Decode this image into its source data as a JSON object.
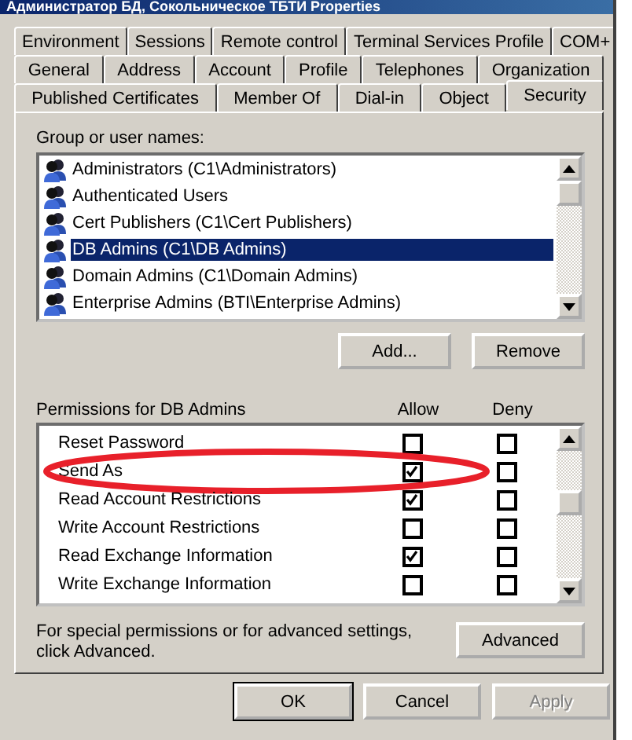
{
  "window": {
    "title": "Администратор БД, Сокольническое ТБТИ Properties"
  },
  "tab_rows": [
    [
      {
        "label": "Environment",
        "selected": false
      },
      {
        "label": "Sessions",
        "selected": false
      },
      {
        "label": "Remote control",
        "selected": false
      },
      {
        "label": "Terminal Services Profile",
        "selected": false
      },
      {
        "label": "COM+",
        "selected": false
      }
    ],
    [
      {
        "label": "General",
        "selected": false
      },
      {
        "label": "Address",
        "selected": false
      },
      {
        "label": "Account",
        "selected": false
      },
      {
        "label": "Profile",
        "selected": false
      },
      {
        "label": "Telephones",
        "selected": false
      },
      {
        "label": "Organization",
        "selected": false
      }
    ],
    [
      {
        "label": "Published Certificates",
        "selected": false
      },
      {
        "label": "Member Of",
        "selected": false
      },
      {
        "label": "Dial-in",
        "selected": false
      },
      {
        "label": "Object",
        "selected": false
      },
      {
        "label": "Security",
        "selected": true
      }
    ]
  ],
  "groups": {
    "label": "Group or user names:",
    "items": [
      {
        "name": "Administrators (C1\\Administrators)",
        "selected": false
      },
      {
        "name": "Authenticated Users",
        "selected": false
      },
      {
        "name": "Cert Publishers (C1\\Cert Publishers)",
        "selected": false
      },
      {
        "name": "DB Admins (C1\\DB Admins)",
        "selected": true
      },
      {
        "name": "Domain Admins (C1\\Domain Admins)",
        "selected": false
      },
      {
        "name": "Enterprise Admins (BTI\\Enterprise Admins)",
        "selected": false
      }
    ],
    "buttons": [
      "Add...",
      "Remove"
    ]
  },
  "permissions": {
    "label": "Permissions for DB Admins",
    "allow_header": "Allow",
    "deny_header": "Deny",
    "rows": [
      {
        "name": "Reset Password",
        "allow": false,
        "deny": false,
        "highlighted": false
      },
      {
        "name": "Send As",
        "allow": true,
        "deny": false,
        "highlighted": true
      },
      {
        "name": "Read Account Restrictions",
        "allow": true,
        "deny": false,
        "highlighted": false
      },
      {
        "name": "Write Account Restrictions",
        "allow": false,
        "deny": false,
        "highlighted": false
      },
      {
        "name": "Read Exchange Information",
        "allow": true,
        "deny": false,
        "highlighted": false
      },
      {
        "name": "Write Exchange Information",
        "allow": false,
        "deny": false,
        "highlighted": false
      }
    ]
  },
  "advanced": {
    "note": "For special permissions or for advanced settings, click Advanced.",
    "button": "Advanced"
  },
  "footer_buttons": [
    {
      "label": "OK",
      "disabled": false
    },
    {
      "label": "Cancel",
      "disabled": false
    },
    {
      "label": "Apply",
      "disabled": true
    }
  ]
}
